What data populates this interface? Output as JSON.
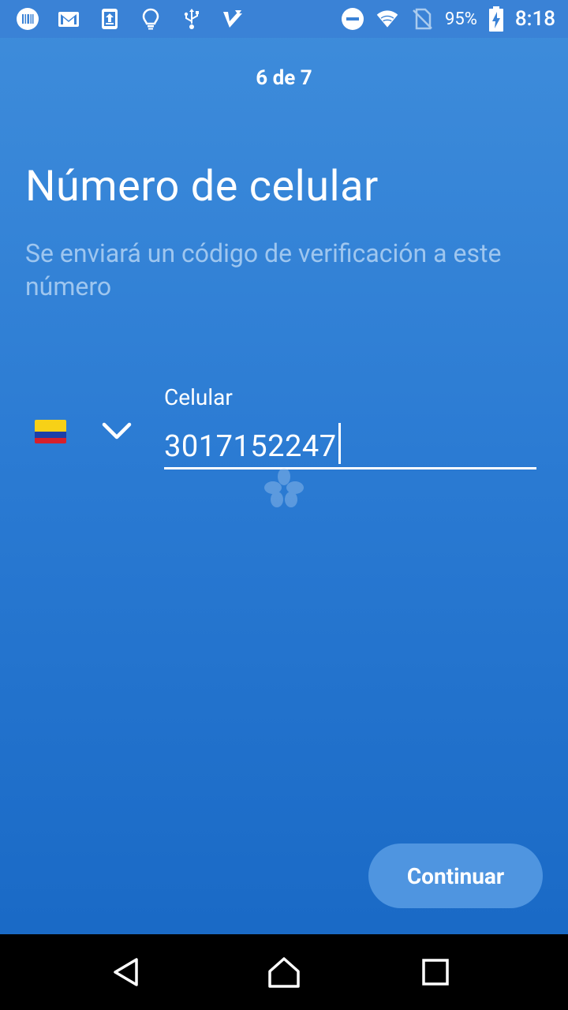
{
  "status_bar": {
    "battery_percent": "95%",
    "time": "8:18",
    "left_icons": [
      "barcode-icon",
      "gmail-icon",
      "upload-icon",
      "lightbulb-icon",
      "usb-icon",
      "checkmark-app-icon"
    ],
    "right_icons": [
      "do-not-disturb-icon",
      "wifi-icon",
      "no-sim-icon",
      "battery-charging-icon"
    ]
  },
  "step": {
    "label": "6 de 7"
  },
  "header": {
    "title": "Número de celular",
    "subtitle": "Se enviará un código de verificación a este número"
  },
  "phone_field": {
    "country_flag": "colombia-flag",
    "label": "Celular",
    "value": "3017152247"
  },
  "actions": {
    "continue_label": "Continuar"
  },
  "colors": {
    "background_top": "#3f8ddb",
    "background_bottom": "#1767c4",
    "subtitle": "#9ec6ef",
    "button": "#4f95e0"
  }
}
